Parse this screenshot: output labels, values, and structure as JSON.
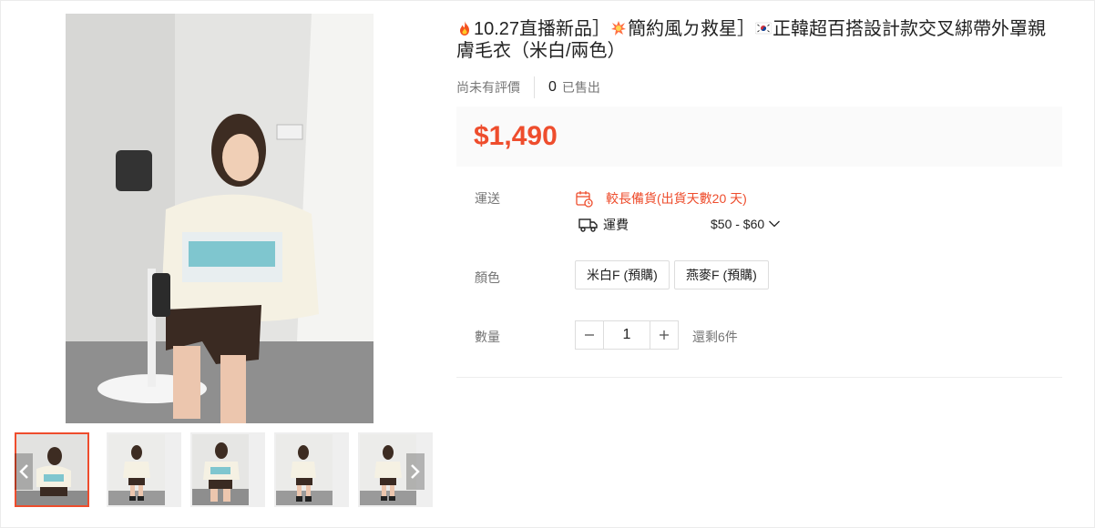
{
  "product": {
    "title_hot": "10.27直播新品］",
    "title_boom": "簡約風ㄉ救星］",
    "title_rest": "正韓超百搭設計款交叉綁帶外罩親膚毛衣（米白/兩色）",
    "rating_text": "尚未有評價",
    "sold_count": "0",
    "sold_label": "已售出",
    "price": "$1,490"
  },
  "shipping": {
    "label": "運送",
    "warning": "較長備貨(出貨天數20 天)",
    "fee_label": "運費",
    "fee_range": "$50 - $60"
  },
  "color": {
    "label": "顏色",
    "options": [
      "米白F (預購)",
      "燕麥F (預購)"
    ]
  },
  "quantity": {
    "label": "數量",
    "value": "1",
    "stock": "還剩6件"
  },
  "gallery": {
    "thumb_count": 5,
    "active_index": 0
  },
  "colors": {
    "accent": "#ee4d2d",
    "price_bg": "#fafafa"
  },
  "icons": {
    "fire": "fire-icon",
    "explosion": "explosion-icon",
    "flag": "korea-flag-icon",
    "calendar": "calendar-icon",
    "truck": "truck-icon",
    "chevron": "chevron-down-icon",
    "minus": "minus-icon",
    "plus": "plus-icon",
    "prev": "chevron-left-icon",
    "next": "chevron-right-icon"
  }
}
